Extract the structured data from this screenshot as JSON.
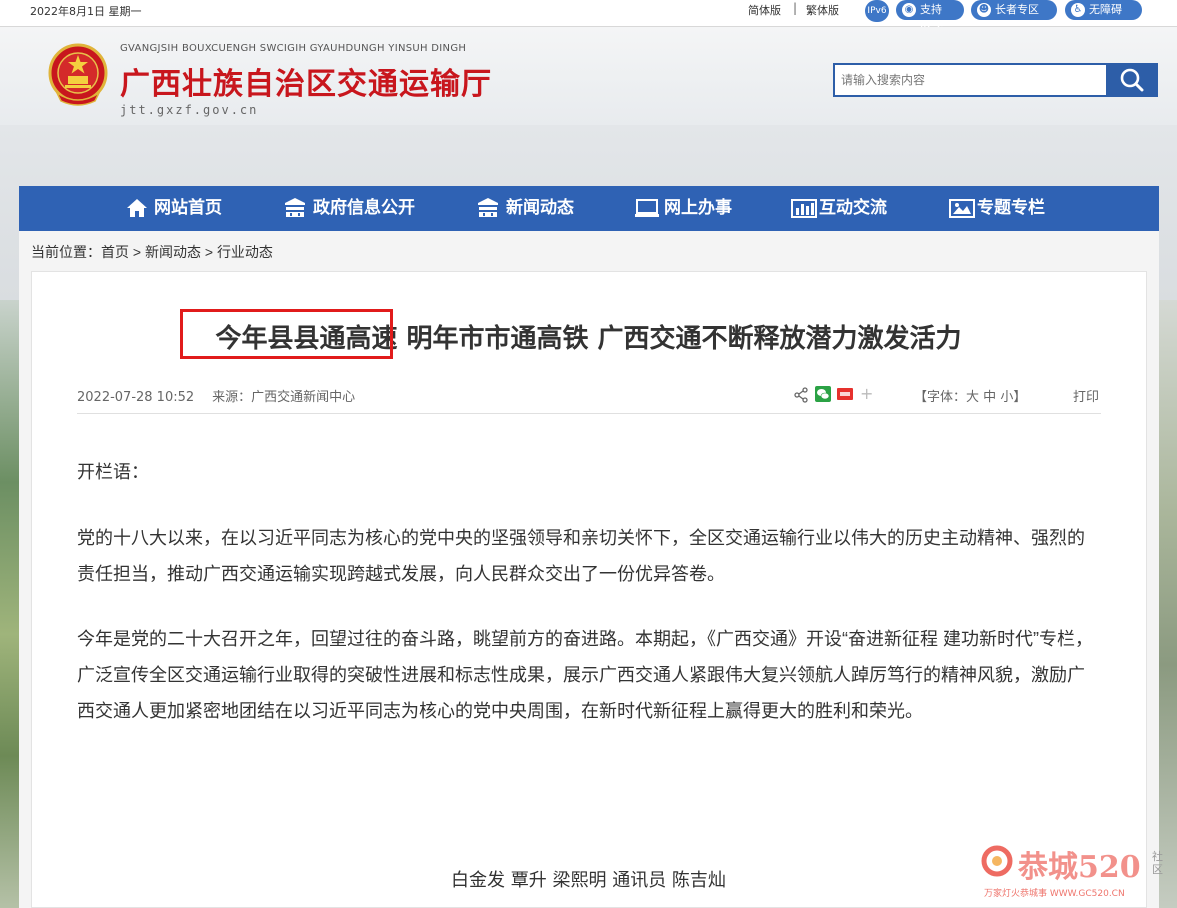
{
  "topbar": {
    "date": "2022年8月1日  星期一",
    "lang_simplified": "简体版",
    "lang_separator": "|",
    "lang_traditional": "繁体版",
    "ipv6_badge": "IPv6",
    "ipv6_label": "支持IPv6",
    "elder_label": "长者专区",
    "accessible_label": "无障碍"
  },
  "header": {
    "pinyin": "GVANGJSIH BOUXCUENGH SWCIGIH GYAUHDUNGH YINSUH DINGH",
    "title": "广西壮族自治区交通运输厅",
    "domain": "jtt.gxzf.gov.cn",
    "search_placeholder": "请输入搜索内容"
  },
  "nav": {
    "items": [
      {
        "label": "网站首页",
        "icon": "home-icon"
      },
      {
        "label": "政府信息公开",
        "icon": "building-icon"
      },
      {
        "label": "新闻动态",
        "icon": "building-icon"
      },
      {
        "label": "网上办事",
        "icon": "monitor-icon"
      },
      {
        "label": "互动交流",
        "icon": "chart-icon"
      },
      {
        "label": "专题专栏",
        "icon": "picture-icon"
      }
    ]
  },
  "breadcrumb": {
    "prefix": "当前位置：",
    "items": [
      "首页",
      "新闻动态",
      "行业动态"
    ],
    "separator": " > "
  },
  "article": {
    "title": "今年县县通高速 明年市市通高铁 广西交通不断释放潜力激发活力",
    "highlighted_text": "今年县县通高速",
    "datetime": "2022-07-28 10:52",
    "source": "来源：广西交通新闻中心",
    "font_ctrl_open": "【字体：",
    "font_large": "大",
    "font_medium": "中",
    "font_small": "小",
    "font_ctrl_close": "】",
    "print": "打印",
    "paragraphs": [
      "开栏语：",
      "党的十八大以来，在以习近平同志为核心的党中央的坚强领导和亲切关怀下，全区交通运输行业以伟大的历史主动精神、强烈的责任担当，推动广西交通运输实现跨越式发展，向人民群众交出了一份优异答卷。",
      "今年是党的二十大召开之年，回望过往的奋斗路，眺望前方的奋进路。本期起，《广西交通》开设“奋进新征程 建功新时代”专栏，广泛宣传全区交通运输行业取得的突破性进展和标志性成果，展示广西交通人紧跟伟大复兴领航人踔厉笃行的精神风貌，激励广西交通人更加紧密地团结在以习近平同志为核心的党中央周围，在新时代新征程上赢得更大的胜利和荣光。"
    ],
    "byline": "白金发 覃升 梁熙明 通讯员 陈吉灿"
  },
  "watermark": {
    "brand": "恭城520",
    "sub": "社区",
    "slogan": "万家灯火恭城事 WWW.GC520.CN"
  },
  "colors": {
    "brand_red": "#c8161d",
    "nav_blue": "#2f62b4",
    "highlight_red": "#e11b1b"
  }
}
